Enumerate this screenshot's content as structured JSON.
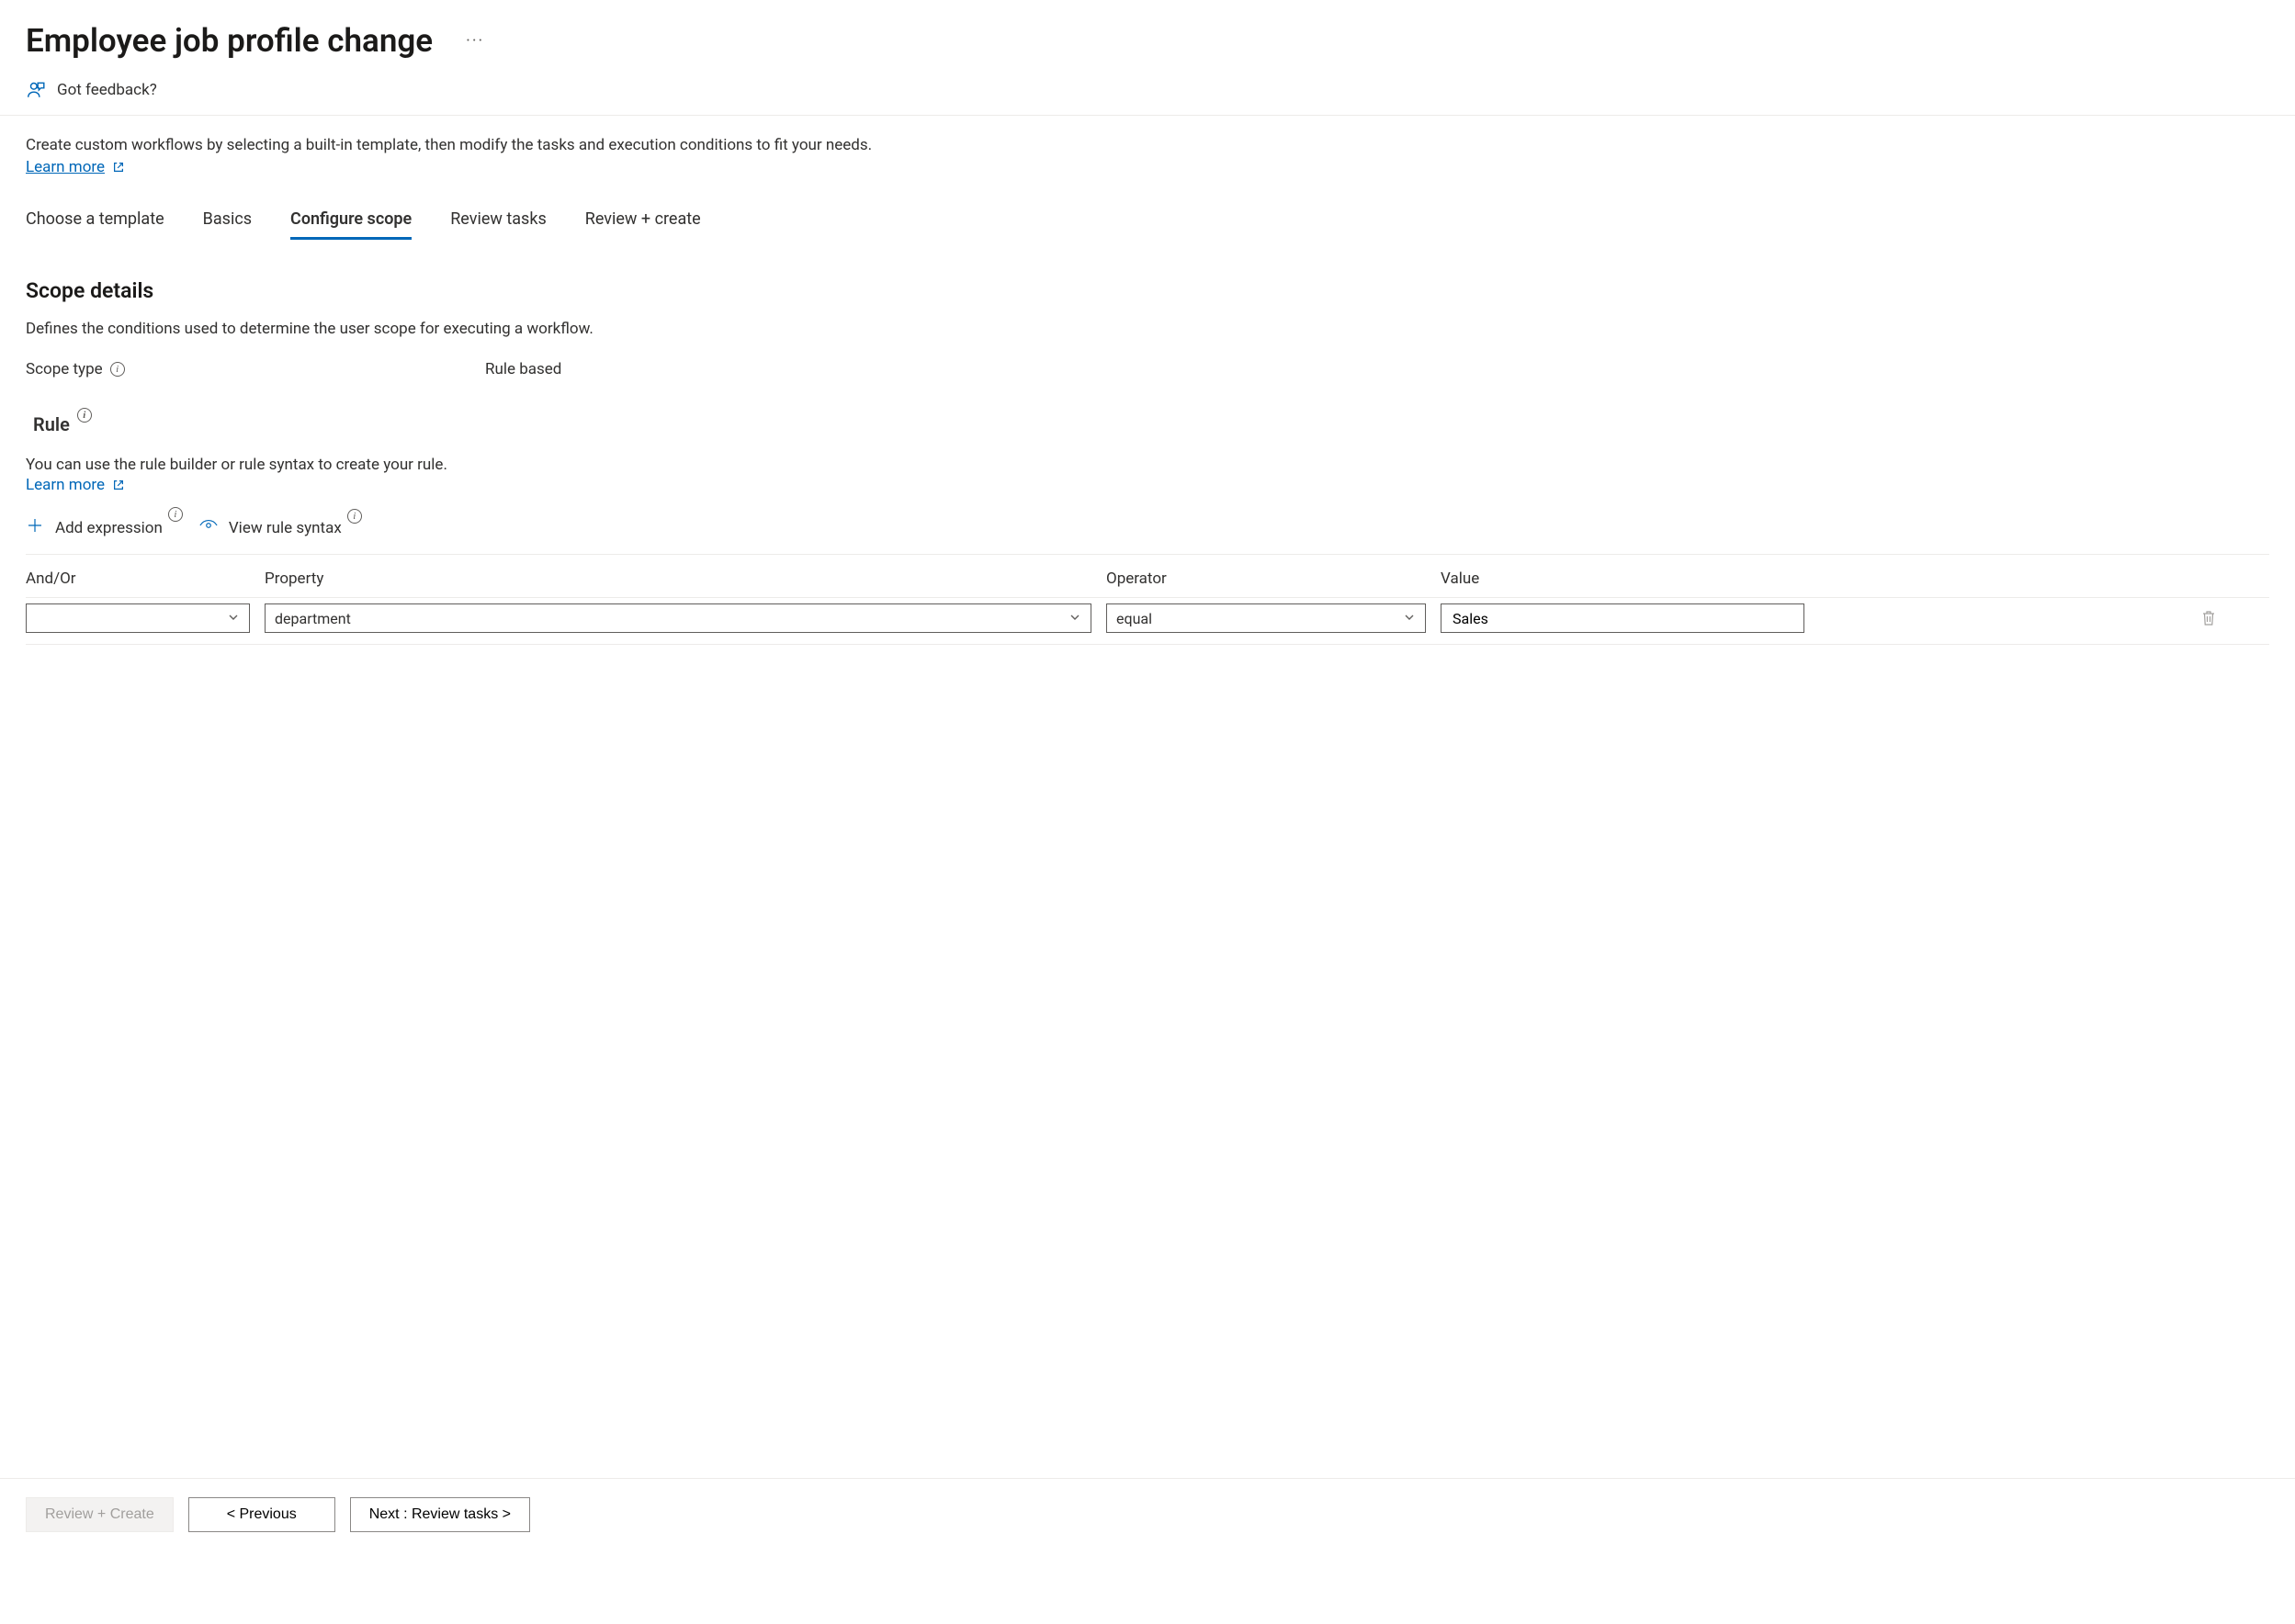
{
  "header": {
    "title": "Employee job profile change"
  },
  "feedback": {
    "label": "Got feedback?"
  },
  "intro": {
    "text": "Create custom workflows by selecting a built-in template, then modify the tasks and execution conditions to fit your needs.",
    "learn_more": "Learn more"
  },
  "tabs": [
    {
      "label": "Choose a template",
      "active": false
    },
    {
      "label": "Basics",
      "active": false
    },
    {
      "label": "Configure scope",
      "active": true
    },
    {
      "label": "Review tasks",
      "active": false
    },
    {
      "label": "Review + create",
      "active": false
    }
  ],
  "scope": {
    "heading": "Scope details",
    "description": "Defines the conditions used to determine the user scope for executing a workflow.",
    "type_label": "Scope type",
    "type_value": "Rule based"
  },
  "rule": {
    "heading": "Rule",
    "description": "You can use the rule builder or rule syntax to create your rule.",
    "learn_more": "Learn more",
    "toolbar": {
      "add_expression": "Add expression",
      "view_syntax": "View rule syntax"
    },
    "columns": {
      "andor": "And/Or",
      "property": "Property",
      "operator": "Operator",
      "value": "Value"
    },
    "rows": [
      {
        "andor": "",
        "property": "department",
        "operator": "equal",
        "value": "Sales"
      }
    ]
  },
  "footer": {
    "review_create": "Review + Create",
    "previous": "< Previous",
    "next": "Next : Review tasks >"
  }
}
